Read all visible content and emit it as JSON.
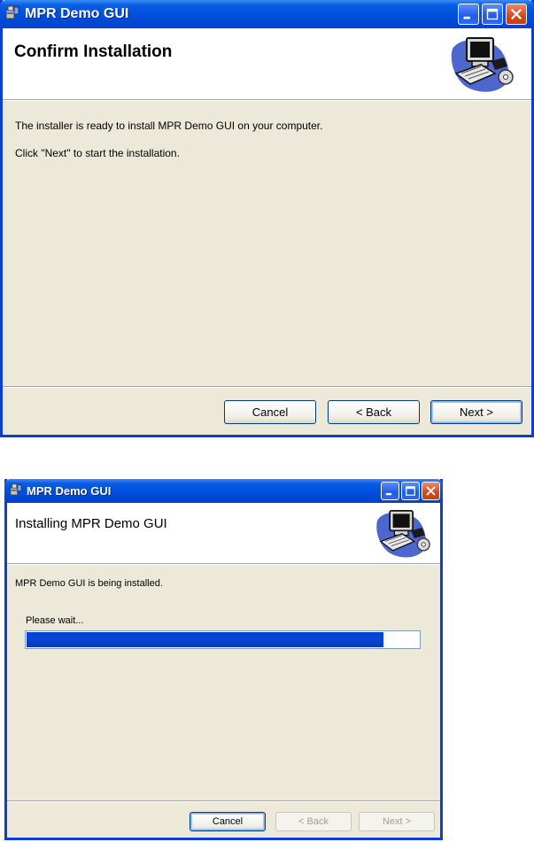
{
  "window1": {
    "title": "MPR Demo GUI",
    "heading": "Confirm Installation",
    "line1": "The installer is ready to install MPR Demo GUI on your computer.",
    "line2": "Click \"Next\" to start the installation.",
    "buttons": {
      "cancel": "Cancel",
      "back": "< Back",
      "next": "Next >"
    }
  },
  "window2": {
    "title": "MPR Demo GUI",
    "heading": "Installing MPR Demo GUI",
    "status": "MPR Demo GUI is being installed.",
    "wait_label": "Please wait...",
    "progress_fraction": 0.91,
    "buttons": {
      "cancel": "Cancel",
      "back": "< Back",
      "next": "Next >"
    }
  },
  "icons": [
    "installer-icon",
    "minimize-icon",
    "maximize-icon",
    "close-icon",
    "computer-setup-illustration"
  ],
  "colors": {
    "titlebar": "#0054e3",
    "dialog_bg": "#ece9d8",
    "progress": "#0a46d8",
    "close_button": "#d04a1e"
  }
}
